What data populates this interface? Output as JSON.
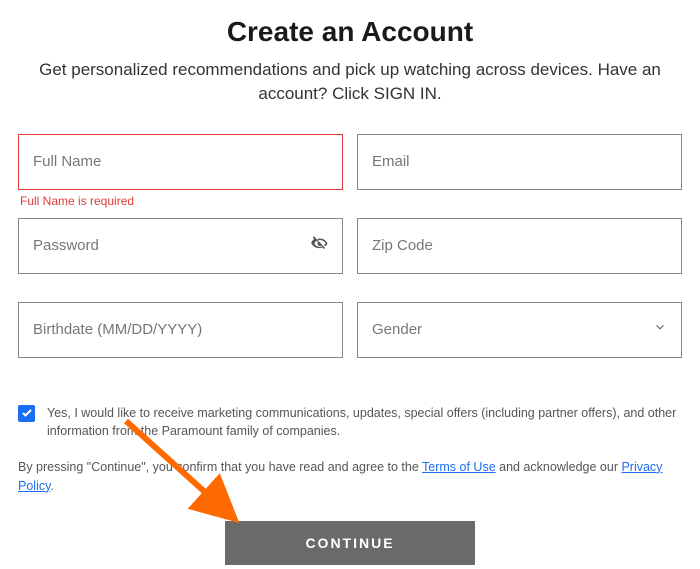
{
  "heading": "Create an Account",
  "subheading": "Get personalized recommendations and pick up watching across devices. Have an account? Click SIGN IN.",
  "fields": {
    "fullName": {
      "placeholder": "Full Name",
      "value": "",
      "error": "Full Name is required"
    },
    "email": {
      "placeholder": "Email",
      "value": ""
    },
    "password": {
      "placeholder": "Password",
      "value": ""
    },
    "zip": {
      "placeholder": "Zip Code",
      "value": ""
    },
    "birthdate": {
      "placeholder": "Birthdate (MM/DD/YYYY)",
      "value": ""
    },
    "gender": {
      "label": "Gender",
      "value": ""
    }
  },
  "marketing": {
    "checked": true,
    "label": "Yes, I would like to receive marketing communications, updates, special offers (including partner offers), and other information from the Paramount family of companies."
  },
  "legal": {
    "prefix": "By pressing \"Continue\", you confirm that you have read and agree to the ",
    "termsLabel": "Terms of Use",
    "middle": " and acknowledge our ",
    "privacyLabel": "Privacy Policy",
    "suffix": "."
  },
  "continueLabel": "CONTINUE"
}
